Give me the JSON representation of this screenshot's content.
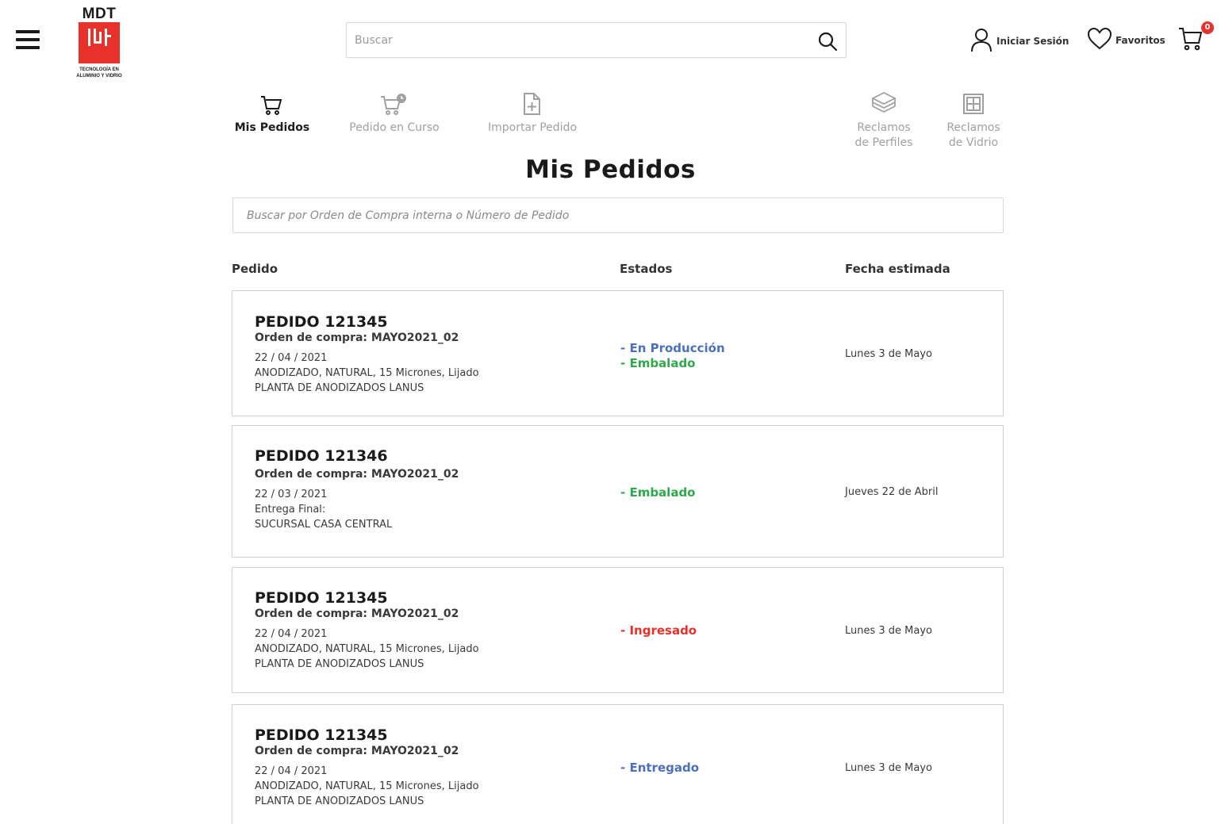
{
  "header": {
    "logo_text": "MDT",
    "logo_tagline_1": "TECNOLOGÍA EN",
    "logo_tagline_2": "ALUMINIO Y VIDRIO",
    "search_placeholder": "Buscar",
    "login_label": "Iniciar Sesión",
    "favorites_label": "Favoritos",
    "cart_count": "0"
  },
  "nav": {
    "mis_pedidos": "Mis Pedidos",
    "pedido_en_curso": "Pedido en Curso",
    "importar_pedido": "Importar Pedido",
    "reclamos_perfiles": "Reclamos\nde Perfiles",
    "reclamos_vidrio": "Reclamos\nde Vidrio"
  },
  "page": {
    "title": "Mis Pedidos",
    "search_placeholder": "Buscar por Orden de Compra interna o Número de Pedido"
  },
  "columns": {
    "pedido": "Pedido",
    "estados": "Estados",
    "fecha": "Fecha estimada"
  },
  "colors": {
    "en_produccion": "#4a6fc4",
    "embalado": "#2eaa4a",
    "ingresado": "#e8312a",
    "entregado": "#4a6fc4",
    "brand_red": "#e8312a"
  },
  "orders": [
    {
      "title": "PEDIDO 121345",
      "oc": "Orden de compra: MAYO2021_02",
      "date": "22 / 04 / 2021",
      "line1": "ANODIZADO, NATURAL, 15 Micrones, Lijado",
      "line2": "PLANTA DE ANODIZADOS LANUS",
      "state1": "- En Producción",
      "state2": "- Embalado",
      "eta": "Lunes 3 de Mayo"
    },
    {
      "title": "PEDIDO 121346",
      "oc": "Orden de compra: MAYO2021_02",
      "date": "22 / 03 / 2021",
      "line1": "Entrega Final:",
      "line2": "SUCURSAL CASA CENTRAL",
      "state1": "- Embalado",
      "eta": "Jueves 22 de Abril"
    },
    {
      "title": "PEDIDO 121345",
      "oc": "Orden de compra: MAYO2021_02",
      "date": "22 / 04 / 2021",
      "line1": "ANODIZADO, NATURAL, 15 Micrones, Lijado",
      "line2": "PLANTA DE ANODIZADOS LANUS",
      "state1": "- Ingresado",
      "eta": "Lunes 3 de Mayo"
    },
    {
      "title": "PEDIDO 121345",
      "oc": "Orden de compra: MAYO2021_02",
      "date": "22 / 04 / 2021",
      "line1": "ANODIZADO, NATURAL, 15 Micrones, Lijado",
      "line2": "PLANTA DE ANODIZADOS LANUS",
      "state1": "- Entregado",
      "eta": "Lunes 3 de Mayo"
    }
  ]
}
